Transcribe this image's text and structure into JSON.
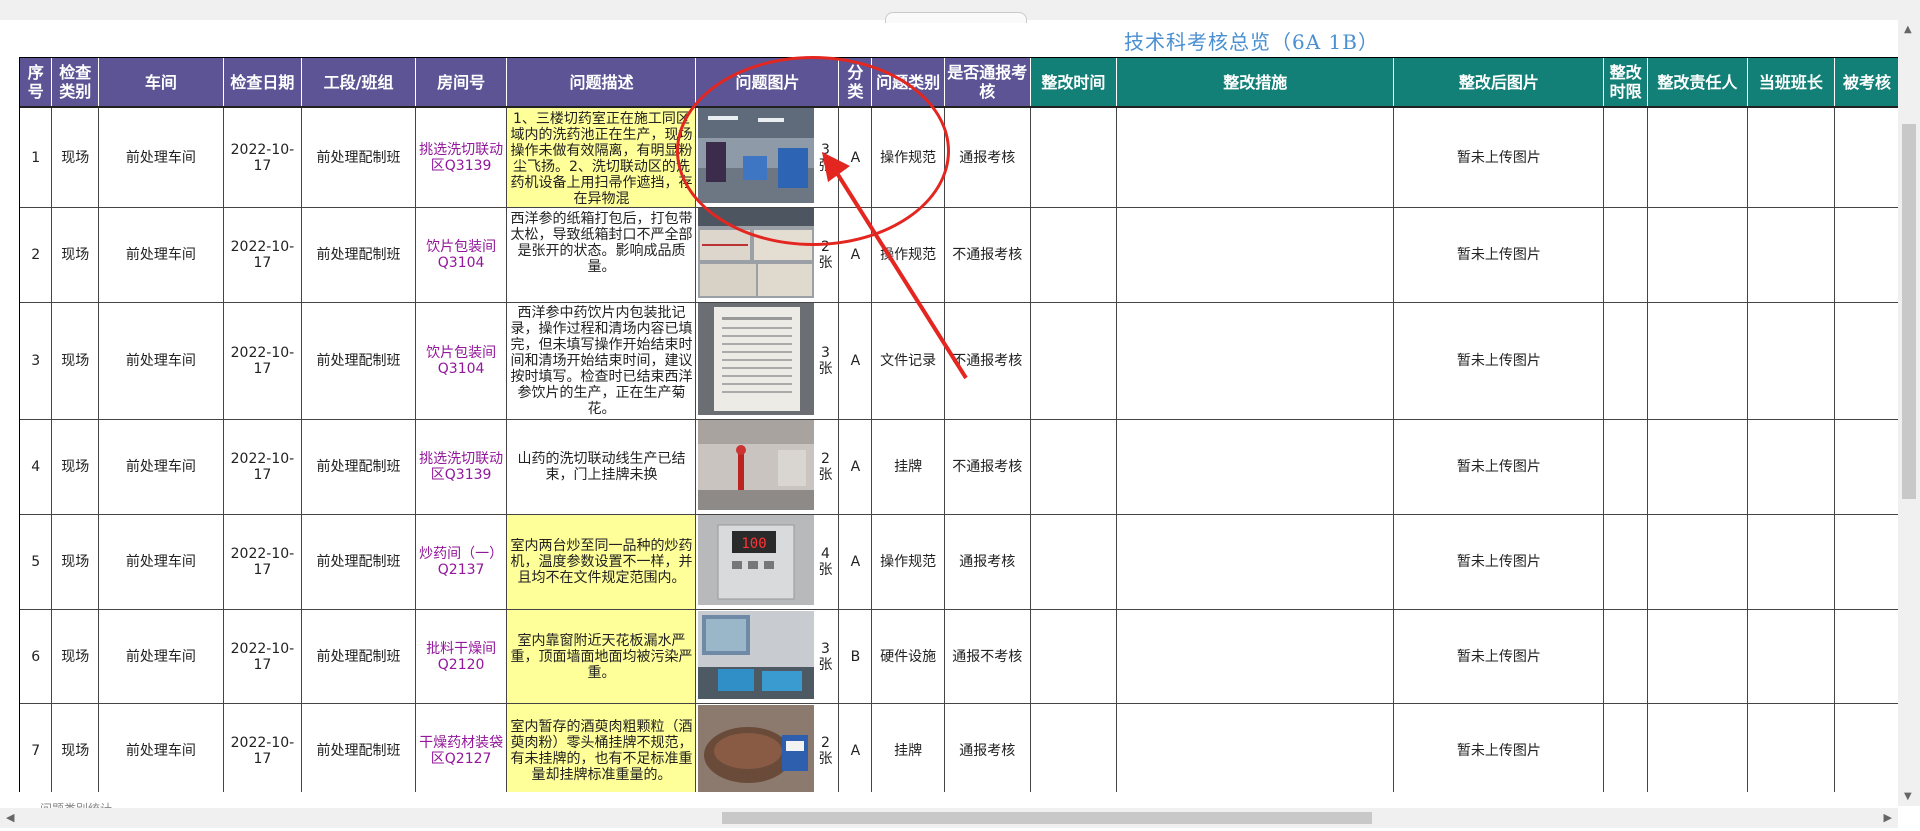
{
  "title": "技术科考核总览（6A 1B）",
  "headers": {
    "seq": "序号",
    "checkType": "检查类别",
    "workshop": "车间",
    "date": "检查日期",
    "section": "工段/班组",
    "room": "房间号",
    "desc": "问题描述",
    "photo": "问题图片",
    "cls": "分类",
    "ptype": "问题类别",
    "notify": "是否通报考核",
    "fixTime": "整改时间",
    "fixMeasure": "整改措施",
    "fixPhoto": "整改后图片",
    "deadline": "整改时限",
    "owner": "整改责任人",
    "leader": "当班班长",
    "assessee": "被考核"
  },
  "rows": [
    {
      "seq": "1",
      "type": "现场",
      "workshop": "前处理车间",
      "date": "2022-10-17",
      "section": "前处理配制班",
      "room": "挑选洗切联动区Q3139",
      "desc": "1、三楼切药室正在施工同区域内的洗药池正在生产，现场操作未做有效隔离，有明显粉尘飞扬。2、洗切联动区的洗药机设备上用扫帚作遮挡，存在异物混",
      "count": "3张",
      "cls": "A",
      "ptype": "操作规范",
      "notify": "通报考核",
      "fixPhoto": "暂未上传图片"
    },
    {
      "seq": "2",
      "type": "现场",
      "workshop": "前处理车间",
      "date": "2022-10-17",
      "section": "前处理配制班",
      "room": "饮片包装间Q3104",
      "desc": "西洋参的纸箱打包后，打包带太松，导致纸箱封口不严全部是张开的状态。影响成品质量。",
      "count": "2张",
      "cls": "A",
      "ptype": "操作规范",
      "notify": "不通报考核",
      "fixPhoto": "暂未上传图片"
    },
    {
      "seq": "3",
      "type": "现场",
      "workshop": "前处理车间",
      "date": "2022-10-17",
      "section": "前处理配制班",
      "room": "饮片包装间Q3104",
      "desc": "西洋参中药饮片内包装批记录，操作过程和清场内容已填完，但未填写操作开始结束时间和清场开始结束时间，建议按时填写。检查时已结束西洋参饮片的生产，正在生产菊花。",
      "count": "3张",
      "cls": "A",
      "ptype": "文件记录",
      "notify": "不通报考核",
      "fixPhoto": "暂未上传图片"
    },
    {
      "seq": "4",
      "type": "现场",
      "workshop": "前处理车间",
      "date": "2022-10-17",
      "section": "前处理配制班",
      "room": "挑选洗切联动区Q3139",
      "desc": "山药的洗切联动线生产已结束，门上挂牌未换",
      "count": "2张",
      "cls": "A",
      "ptype": "挂牌",
      "notify": "不通报考核",
      "fixPhoto": "暂未上传图片"
    },
    {
      "seq": "5",
      "type": "现场",
      "workshop": "前处理车间",
      "date": "2022-10-17",
      "section": "前处理配制班",
      "room": "炒药间（一）Q2137",
      "desc": "室内两台炒至同一品种的炒药机，温度参数设置不一样，并且均不在文件规定范围内。",
      "count": "4张",
      "cls": "A",
      "ptype": "操作规范",
      "notify": "通报考核",
      "fixPhoto": "暂未上传图片",
      "display": "100"
    },
    {
      "seq": "6",
      "type": "现场",
      "workshop": "前处理车间",
      "date": "2022-10-17",
      "section": "前处理配制班",
      "room": "批料干燥间Q2120",
      "desc": "室内靠窗附近天花板漏水严重，顶面墙面地面均被污染严重。",
      "count": "3张",
      "cls": "B",
      "ptype": "硬件设施",
      "notify": "通报不考核",
      "fixPhoto": "暂未上传图片"
    },
    {
      "seq": "7",
      "type": "现场",
      "workshop": "前处理车间",
      "date": "2022-10-17",
      "section": "前处理配制班",
      "room": "干燥药材装袋区Q2127",
      "desc": "室内暂存的酒萸肉粗颗粒（酒萸肉粉）零头桶挂牌不规范，有未挂牌的，也有不足标准重量却挂牌标准重量的。",
      "count": "2张",
      "cls": "A",
      "ptype": "挂牌",
      "notify": "通报考核",
      "fixPhoto": "暂未上传图片"
    }
  ],
  "footnote": "问题类别统计",
  "colors": {
    "headerPurple": "#5d5495",
    "headerTeal": "#138077",
    "descBg": "#ffff99",
    "roomText": "#92179a",
    "annotation": "#e3261f"
  }
}
